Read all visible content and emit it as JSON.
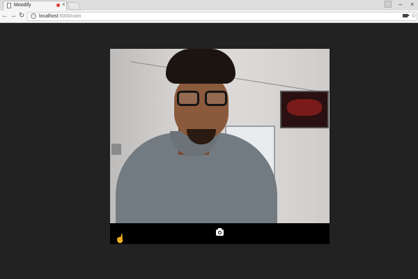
{
  "tab": {
    "title": "Moodify",
    "close": "×",
    "recording_color": "#e53935"
  },
  "window": {
    "minimize": "–",
    "close": "×"
  },
  "nav": {
    "back": "←",
    "forward": "→",
    "reload": "↻"
  },
  "address": {
    "host": "localhost",
    "path": ":5000/cam",
    "info": "i"
  },
  "icons": {
    "star": "☆",
    "cursor": "☝"
  }
}
